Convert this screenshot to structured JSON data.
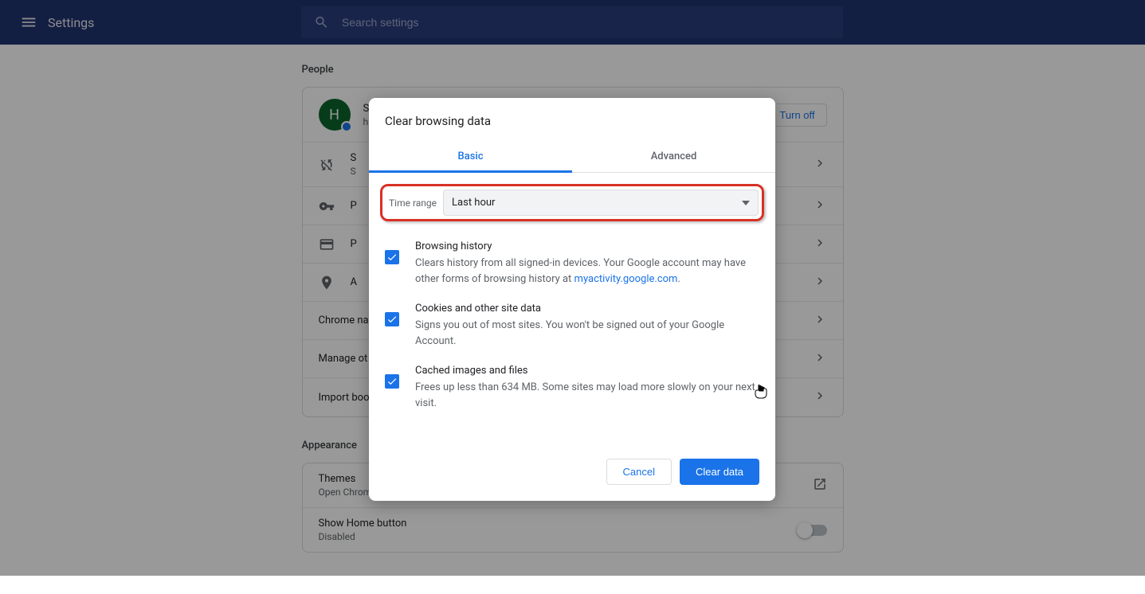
{
  "header": {
    "title": "Settings",
    "search_placeholder": "Search settings"
  },
  "sections": {
    "people": "People",
    "appearance": "Appearance"
  },
  "profile": {
    "initial": "H",
    "name": "S",
    "email": "h",
    "turn_off": "Turn off"
  },
  "rows": {
    "sync_title": "S",
    "sync_sub": "S",
    "passwords": "P",
    "payments": "P",
    "addresses": "A",
    "chrome_name": "Chrome na",
    "manage_other": "Manage ot",
    "import": "Import boo",
    "themes_title": "Themes",
    "themes_sub": "Open Chrome Web Store",
    "home_title": "Show Home button",
    "home_sub": "Disabled"
  },
  "dialog": {
    "title": "Clear browsing data",
    "tab_basic": "Basic",
    "tab_advanced": "Advanced",
    "time_range_label": "Time range",
    "time_range_value": "Last hour",
    "items": [
      {
        "title": "Browsing history",
        "desc_pre": "Clears history from all signed-in devices. Your Google account may have other forms of browsing history at ",
        "link": "myactivity.google.com",
        "desc_post": "."
      },
      {
        "title": "Cookies and other site data",
        "desc": "Signs you out of most sites. You won't be signed out of your Google Account."
      },
      {
        "title": "Cached images and files",
        "desc": "Frees up less than 634 MB. Some sites may load more slowly on your next visit."
      }
    ],
    "cancel": "Cancel",
    "confirm": "Clear data"
  }
}
